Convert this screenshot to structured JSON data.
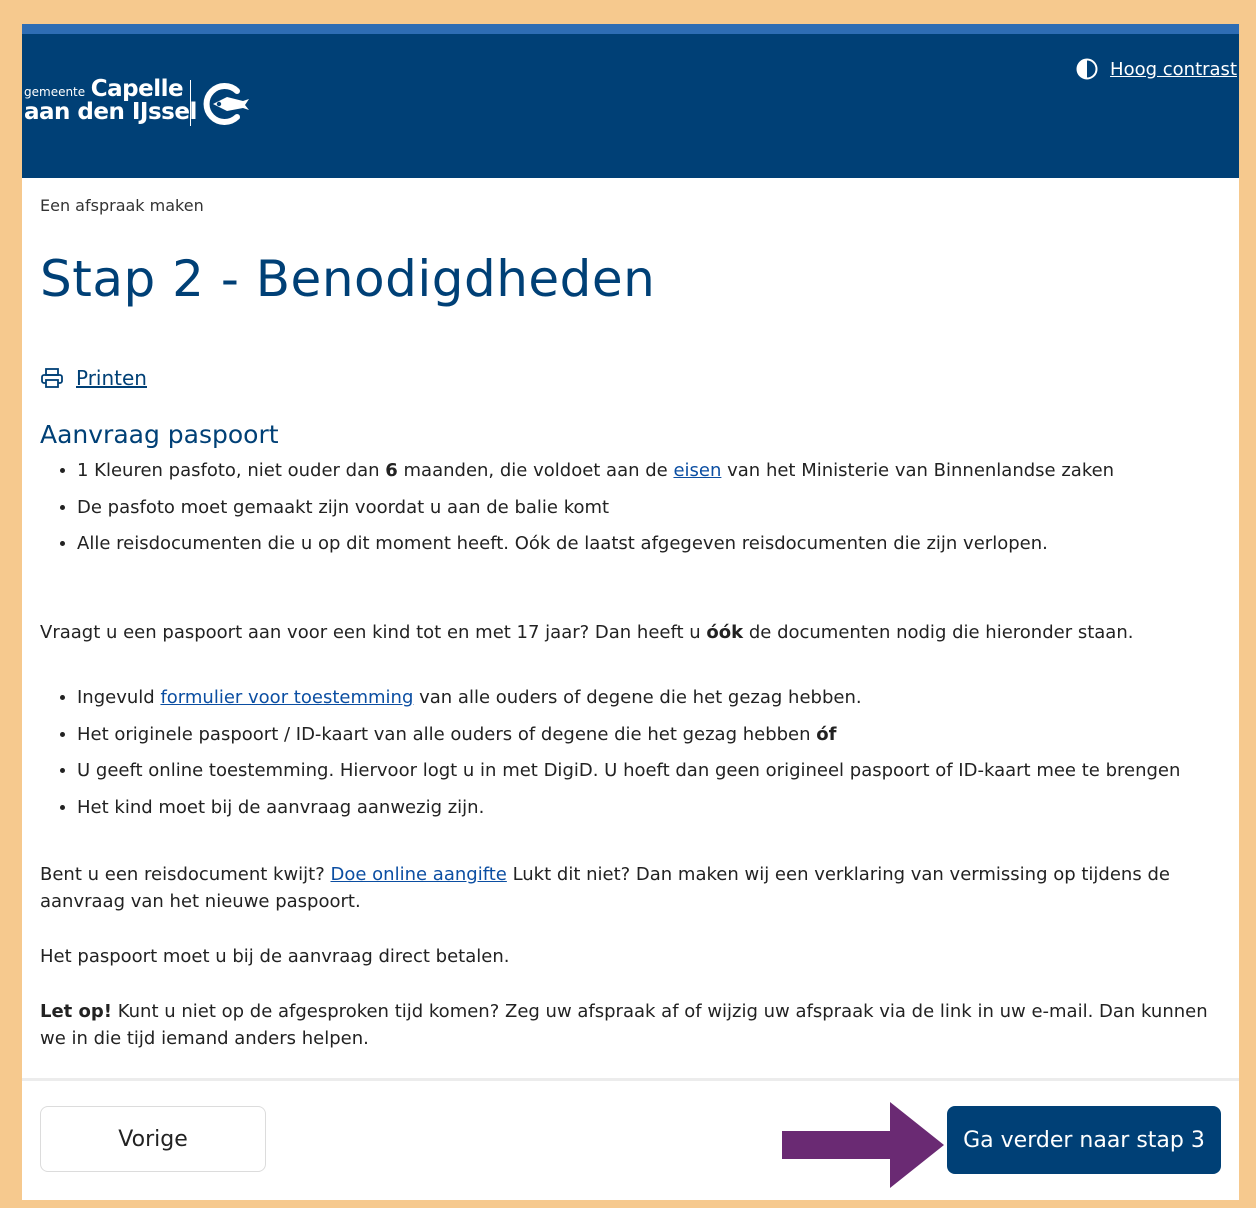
{
  "header": {
    "logo": {
      "line1_small": "gemeente",
      "line1_big": "Capelle",
      "line2": "aan den IJssel"
    },
    "contrast_label": "Hoog contrast",
    "contrast_icon": "half-circle-contrast-icon"
  },
  "breadcrumb": "Een afspraak maken",
  "page_title": "Stap 2 - Benodigdheden",
  "print": {
    "label": "Printen",
    "icon": "printer-icon"
  },
  "section_title": "Aanvraag paspoort",
  "list1": [
    {
      "pre": "1 Kleuren pasfoto, niet ouder dan ",
      "bold": "6",
      "mid": " maanden, die voldoet aan de ",
      "link": "eisen",
      "post": " van het Ministerie van Binnenlandse zaken"
    },
    {
      "text": "De pasfoto moet gemaakt zijn voordat u aan de balie komt"
    },
    {
      "text": "Alle reisdocumenten die u op dit moment heeft. Oók de laatst afgegeven reisdocumenten die zijn verlopen."
    }
  ],
  "para_child": {
    "pre": "Vraagt u een paspoort aan voor een kind tot en met 17 jaar? Dan heeft u ",
    "bold": "óók",
    "post": " de documenten nodig die hieronder staan."
  },
  "list2": [
    {
      "pre": "Ingevuld ",
      "link": "formulier voor toestemming",
      "post": " van alle ouders of degene die het gezag hebben."
    },
    {
      "pre": "Het originele paspoort / ID-kaart van alle ouders of degene die het gezag hebben ",
      "bold": "óf"
    },
    {
      "text": "U geeft online toestemming. Hiervoor logt u in met DigiD. U hoeft dan geen origineel paspoort of ID-kaart mee te brengen"
    },
    {
      "text": "Het kind moet bij de aanvraag aanwezig zijn."
    }
  ],
  "para_lost": {
    "pre": "Bent u een reisdocument kwijt? ",
    "link": "Doe online aangifte",
    "post": " Lukt dit niet? Dan maken wij een verklaring van vermissing op tijdens de aanvraag van het nieuwe paspoort."
  },
  "para_pay": "Het paspoort moet u bij de aanvraag direct betalen.",
  "para_note": {
    "bold": "Let op!",
    "post": " Kunt u niet op de afgesproken tijd komen? Zeg uw afspraak af of wijzig uw afspraak via de link in uw e-mail. Dan kunnen we in die tijd iemand anders helpen."
  },
  "buttons": {
    "prev": "Vorige",
    "next": "Ga verder naar stap 3"
  },
  "colors": {
    "brand_blue": "#004076",
    "accent_stripe": "#2e6db4",
    "frame_border": "#f6c98e",
    "arrow_purple": "#6a2a73",
    "link": "#0b4ea2"
  }
}
